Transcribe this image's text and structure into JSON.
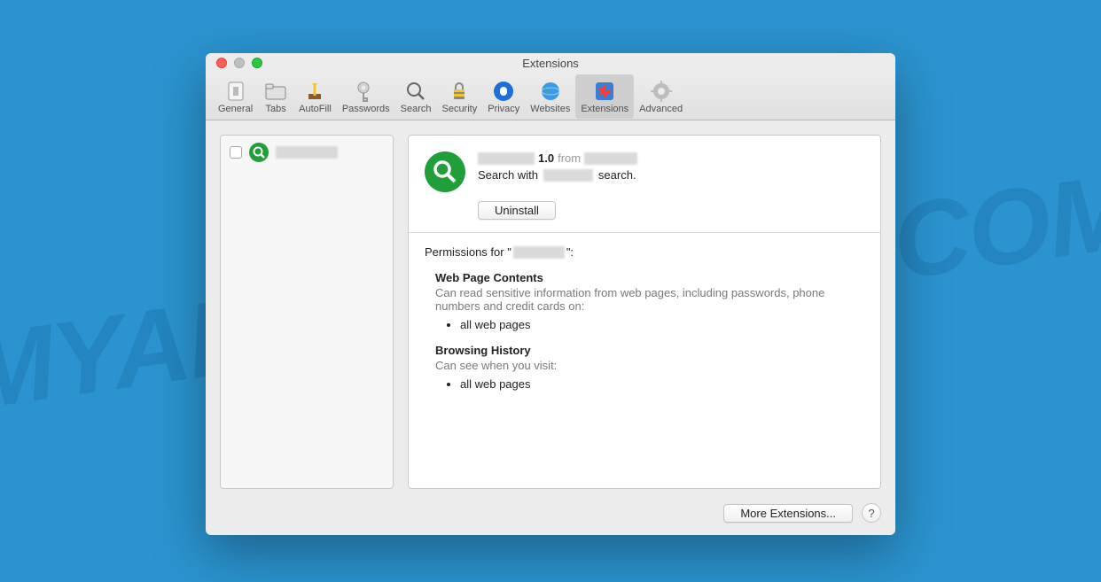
{
  "watermark": "MYANTISPYWARE.COM",
  "window": {
    "title": "Extensions"
  },
  "toolbar": {
    "items": [
      {
        "label": "General"
      },
      {
        "label": "Tabs"
      },
      {
        "label": "AutoFill"
      },
      {
        "label": "Passwords"
      },
      {
        "label": "Search"
      },
      {
        "label": "Security"
      },
      {
        "label": "Privacy"
      },
      {
        "label": "Websites"
      },
      {
        "label": "Extensions"
      },
      {
        "label": "Advanced"
      }
    ]
  },
  "extension": {
    "version": "1.0",
    "from_label": "from",
    "description_prefix": "Search with",
    "description_suffix": "search.",
    "uninstall_label": "Uninstall",
    "permissions_prefix": "Permissions for \"",
    "permissions_suffix": "\":",
    "perms": {
      "webcontent": {
        "title": "Web Page Contents",
        "desc": "Can read sensitive information from web pages, including passwords, phone numbers and credit cards on:",
        "items": [
          "all web pages"
        ]
      },
      "history": {
        "title": "Browsing History",
        "desc": "Can see when you visit:",
        "items": [
          "all web pages"
        ]
      }
    }
  },
  "footer": {
    "more_extensions": "More Extensions...",
    "help": "?"
  }
}
